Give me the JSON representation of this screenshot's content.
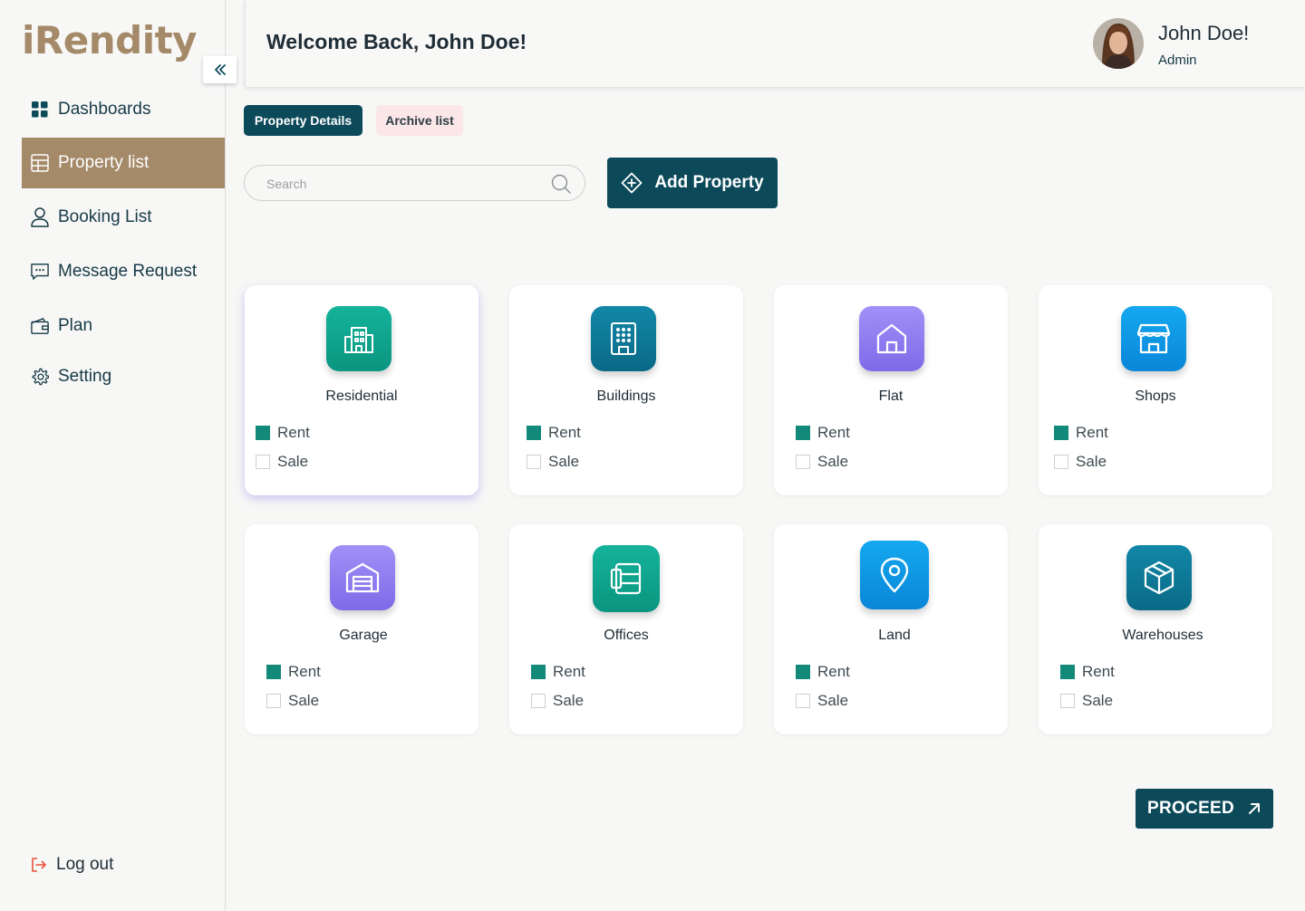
{
  "brand": {
    "logo": "iRendity"
  },
  "sidebar": {
    "items": [
      {
        "label": "Dashboards",
        "icon": "grid-icon"
      },
      {
        "label": "Property list",
        "icon": "table-icon",
        "active": true
      },
      {
        "label": "Booking List",
        "icon": "user-icon"
      },
      {
        "label": "Message Request",
        "icon": "message-icon"
      },
      {
        "label": "Plan",
        "icon": "wallet-icon"
      },
      {
        "label": "Setting",
        "icon": "gear-icon"
      }
    ],
    "logout": "Log out"
  },
  "header": {
    "welcome": "Welcome Back, John Doe!",
    "user_name": "John Doe!",
    "user_role": "Admin"
  },
  "tabs": {
    "details": "Property Details",
    "archive": "Archive list"
  },
  "search": {
    "placeholder": "Search"
  },
  "actions": {
    "add_property": "Add Property",
    "proceed": "PROCEED"
  },
  "options": {
    "rent": "Rent",
    "sale": "Sale"
  },
  "cards": [
    {
      "title": "Residential",
      "icon": "residential-icon",
      "rent": true,
      "sale": false
    },
    {
      "title": "Buildings",
      "icon": "building-icon",
      "rent": true,
      "sale": false
    },
    {
      "title": "Flat",
      "icon": "home-icon",
      "rent": true,
      "sale": false
    },
    {
      "title": "Shops",
      "icon": "shop-icon",
      "rent": true,
      "sale": false
    },
    {
      "title": "Garage",
      "icon": "garage-icon",
      "rent": true,
      "sale": false
    },
    {
      "title": "Offices",
      "icon": "office-icon",
      "rent": true,
      "sale": false
    },
    {
      "title": "Land",
      "icon": "map-pin-icon",
      "rent": true,
      "sale": false
    },
    {
      "title": "Warehouses",
      "icon": "box-icon",
      "rent": true,
      "sale": false
    }
  ],
  "colors": {
    "primary": "#0c4a5a",
    "brand": "#a58a6a",
    "check": "#13897a"
  }
}
